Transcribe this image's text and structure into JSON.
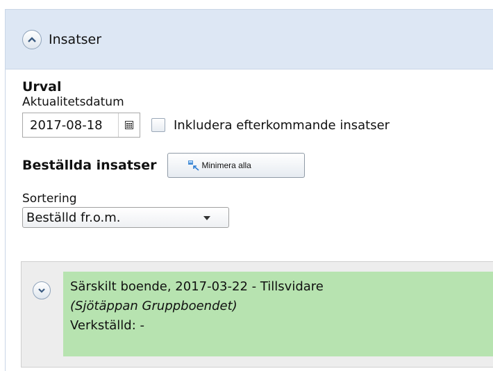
{
  "header": {
    "title": "Insatser"
  },
  "urval": {
    "title": "Urval",
    "date_label": "Aktualitetsdatum",
    "date_value": "2017-08-18",
    "include_label": "Inkludera efterkommande insatser"
  },
  "ordered": {
    "title": "Beställda insatser",
    "minimize_label": "Minimera alla"
  },
  "sorting": {
    "label": "Sortering",
    "selected": "Beställd fr.o.m."
  },
  "insats": {
    "line1": "Särskilt boende, 2017-03-22 - Tillsvidare",
    "line2": "(Sjötäppan Gruppboendet)",
    "line3": "Verkställd: -"
  },
  "colors": {
    "header_bg": "#dde7f4",
    "insats_green": "#b7e3b0",
    "insats_grey": "#ededed"
  }
}
